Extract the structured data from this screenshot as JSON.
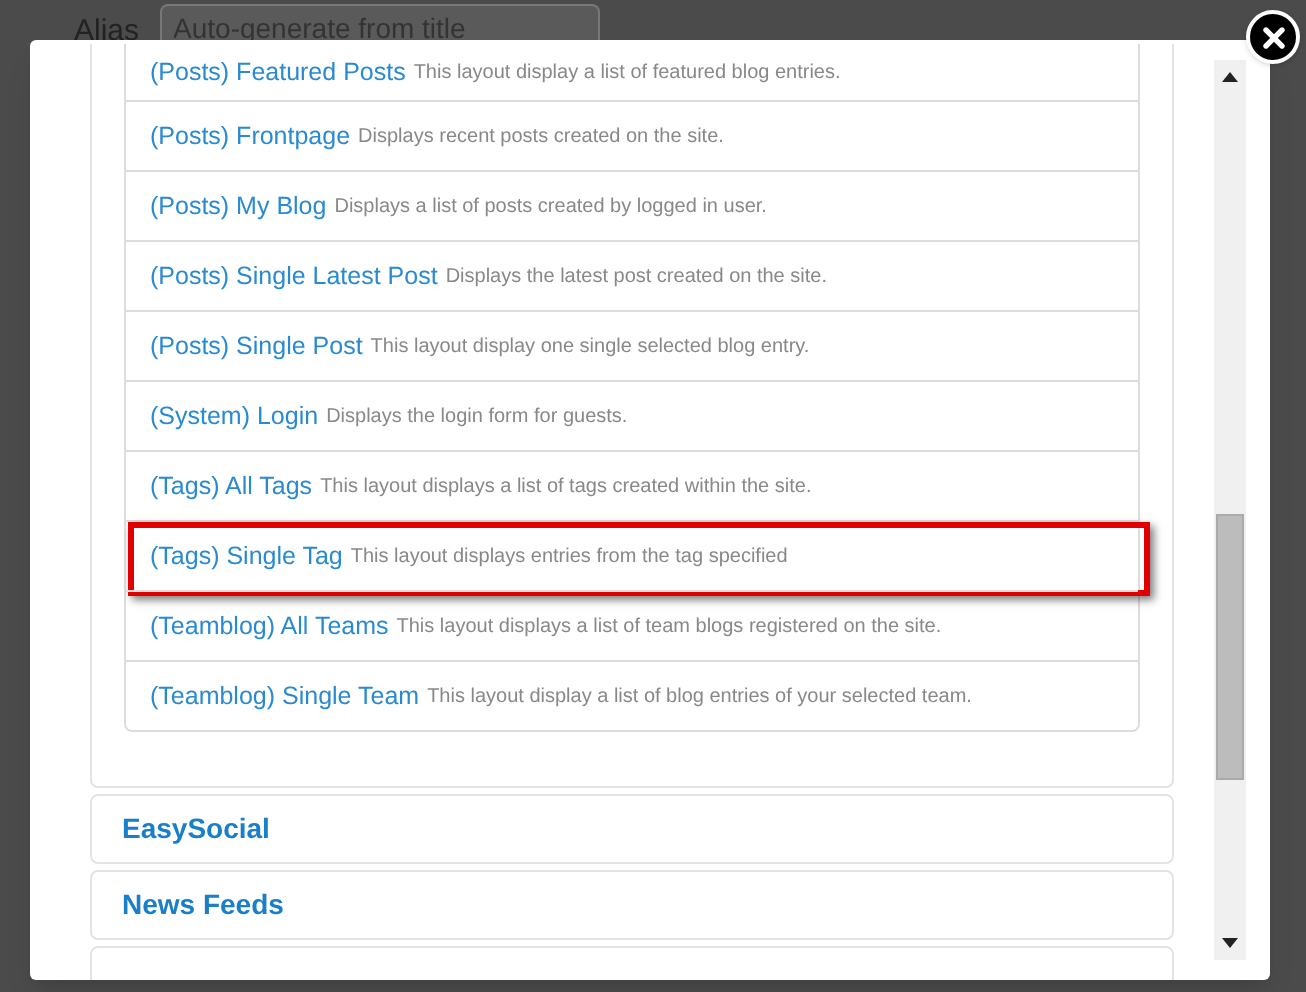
{
  "background_form": {
    "label": "Alias",
    "placeholder": "Auto-generate from title"
  },
  "layouts": [
    {
      "title": "(Posts) Featured Posts",
      "description": "This layout display a list of featured blog entries.",
      "highlighted": false
    },
    {
      "title": "(Posts) Frontpage",
      "description": "Displays recent posts created on the site.",
      "highlighted": false
    },
    {
      "title": "(Posts) My Blog",
      "description": "Displays a list of posts created by logged in user.",
      "highlighted": false
    },
    {
      "title": "(Posts) Single Latest Post",
      "description": "Displays the latest post created on the site.",
      "highlighted": false
    },
    {
      "title": "(Posts) Single Post",
      "description": "This layout display one single selected blog entry.",
      "highlighted": false
    },
    {
      "title": "(System) Login",
      "description": "Displays the login form for guests.",
      "highlighted": false
    },
    {
      "title": "(Tags) All Tags",
      "description": "This layout displays a list of tags created within the site.",
      "highlighted": false
    },
    {
      "title": "(Tags) Single Tag",
      "description": "This layout displays entries from the tag specified",
      "highlighted": true
    },
    {
      "title": "(Teamblog) All Teams",
      "description": "This layout displays a list of team blogs registered on the site.",
      "highlighted": false
    },
    {
      "title": "(Teamblog) Single Team",
      "description": "This layout display a list of blog entries of your selected team.",
      "highlighted": false
    }
  ],
  "groups": [
    {
      "title": "EasySocial"
    },
    {
      "title": "News Feeds"
    }
  ]
}
